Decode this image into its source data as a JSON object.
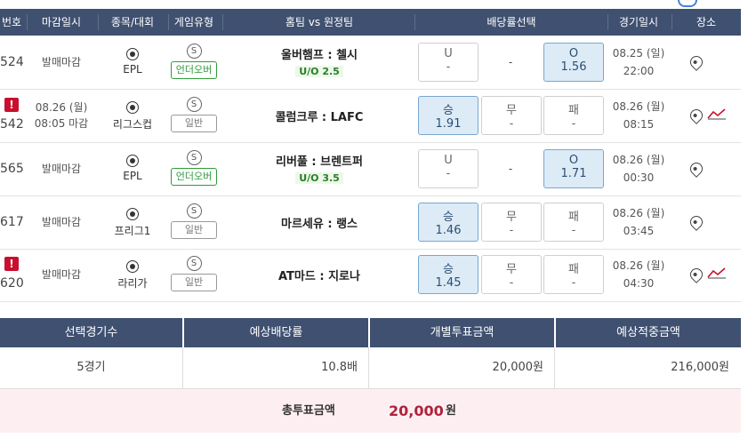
{
  "header": {
    "num": "번호",
    "deadline": "마감일시",
    "sport": "종목/대회",
    "game_type": "게임유형",
    "teams": "홈팀 vs 원정팀",
    "odds": "배당률선택",
    "game_date": "경기일시",
    "venue": "장소"
  },
  "rows": [
    {
      "num": "524",
      "alert": false,
      "deadline1": "발매마감",
      "deadline2": "",
      "league": "EPL",
      "type_icon": "S",
      "type": "언더오버",
      "type_style": "green",
      "teams": "울버햄프 : 첼시",
      "uo": "U/O 2.5",
      "o1": {
        "label": "U",
        "value": "-",
        "selected": false
      },
      "o2": {
        "label": "-",
        "value": "",
        "dash": true
      },
      "o3": {
        "label": "O",
        "value": "1.56",
        "selected": true
      },
      "date": "08.25 (일)",
      "time": "22:00",
      "trend": false
    },
    {
      "num": "542",
      "alert": true,
      "deadline1": "08.26 (월)",
      "deadline2": "08:05 마감",
      "league": "리그스컵",
      "type_icon": "S",
      "type": "일반",
      "type_style": "gray",
      "teams": "콜럼크루 : LAFC",
      "uo": "",
      "o1": {
        "label": "승",
        "value": "1.91",
        "selected": true
      },
      "o2": {
        "label": "무",
        "value": "-",
        "selected": false
      },
      "o3": {
        "label": "패",
        "value": "-",
        "selected": false
      },
      "date": "08.26 (월)",
      "time": "08:15",
      "trend": true
    },
    {
      "num": "565",
      "alert": false,
      "deadline1": "발매마감",
      "deadline2": "",
      "league": "EPL",
      "type_icon": "S",
      "type": "언더오버",
      "type_style": "green",
      "teams": "리버풀 : 브렌트퍼",
      "uo": "U/O 3.5",
      "o1": {
        "label": "U",
        "value": "-",
        "selected": false
      },
      "o2": {
        "label": "-",
        "value": "",
        "dash": true
      },
      "o3": {
        "label": "O",
        "value": "1.71",
        "selected": true
      },
      "date": "08.26 (월)",
      "time": "00:30",
      "trend": false
    },
    {
      "num": "617",
      "alert": false,
      "deadline1": "발매마감",
      "deadline2": "",
      "league": "프리그1",
      "type_icon": "S",
      "type": "일반",
      "type_style": "gray",
      "teams": "마르세유 : 랭스",
      "uo": "",
      "o1": {
        "label": "승",
        "value": "1.46",
        "selected": true
      },
      "o2": {
        "label": "무",
        "value": "-",
        "selected": false
      },
      "o3": {
        "label": "패",
        "value": "-",
        "selected": false
      },
      "date": "08.26 (월)",
      "time": "03:45",
      "trend": false
    },
    {
      "num": "620",
      "alert": true,
      "deadline1": "발매마감",
      "deadline2": "",
      "league": "라리가",
      "type_icon": "S",
      "type": "일반",
      "type_style": "gray",
      "teams": "AT마드 : 지로나",
      "uo": "",
      "o1": {
        "label": "승",
        "value": "1.45",
        "selected": true
      },
      "o2": {
        "label": "무",
        "value": "-",
        "selected": false
      },
      "o3": {
        "label": "패",
        "value": "-",
        "selected": false
      },
      "date": "08.26 (월)",
      "time": "04:30",
      "trend": true
    }
  ],
  "alert_symbol": "!",
  "summary": {
    "headers": [
      "선택경기수",
      "예상배당률",
      "개별투표금액",
      "예상적중금액"
    ],
    "values": [
      "5경기",
      "10.8배",
      "20,000원",
      "216,000원"
    ]
  },
  "total": {
    "label": "총투표금액",
    "amount": "20,000",
    "unit": "원"
  },
  "colors": {
    "header_bg": "#3f5070",
    "selected_bg": "#ddebf7",
    "alert": "#c8102e",
    "total_bg": "#fdeff1",
    "total_amount": "#b0213e",
    "green_badge": "#2e9a3a"
  }
}
